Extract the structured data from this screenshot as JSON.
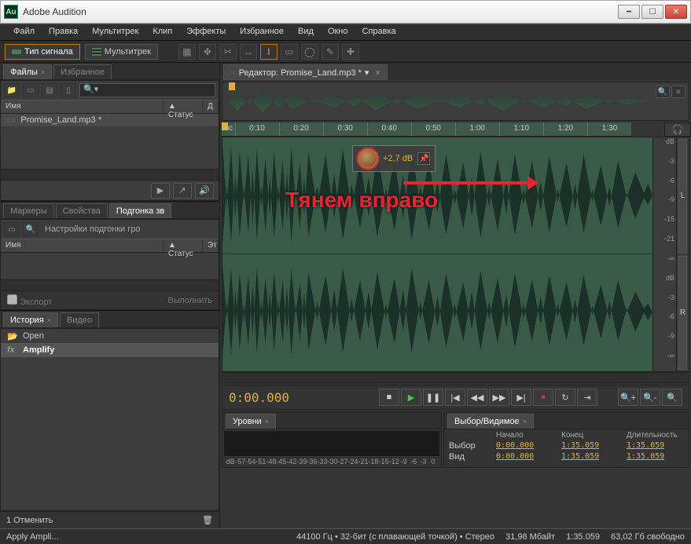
{
  "window": {
    "title": "Adobe Audition",
    "app_icon_text": "Au"
  },
  "win_buttons": {
    "min": "━",
    "max": "☐",
    "close": "✕"
  },
  "menu": [
    "Файл",
    "Правка",
    "Мультитрек",
    "Клип",
    "Эффекты",
    "Избранное",
    "Вид",
    "Окно",
    "Справка"
  ],
  "modes": {
    "signal": "Тип сигнала",
    "multitrack": "Мультитрек"
  },
  "left": {
    "files_tabs": {
      "files": "Файлы",
      "favorites": "Избранное"
    },
    "columns": {
      "name": "Имя",
      "status": "Статус",
      "dur": "Д"
    },
    "file": "Promise_Land.mp3 *",
    "markers_tabs": {
      "markers": "Маркеры",
      "props": "Свойства",
      "fit": "Подгонка зв"
    },
    "fit_settings": "Настройки подгонки гро",
    "columns2": {
      "name": "Имя",
      "status": "Статус",
      "et": "Эт"
    },
    "export": "Экспорт",
    "execute": "Выполнить",
    "history_tabs": {
      "history": "История",
      "video": "Видео"
    },
    "hist_open": "Open",
    "hist_amplify": "Amplify",
    "undo": "1 Отменить"
  },
  "editor": {
    "tab": "Редактор: Promise_Land.mp3 *",
    "timeline_unit": "мс",
    "timeline": [
      "0:10",
      "0:20",
      "0:30",
      "0:40",
      "0:50",
      "1:00",
      "1:10",
      "1:20",
      "1:30"
    ],
    "db_labels": [
      "dB",
      "-3",
      "-6",
      "-9",
      "-15",
      "-21",
      "-∞"
    ],
    "channel_L": "L",
    "channel_R": "R",
    "hud_value": "+2,7 dB",
    "annotation": "Тянем вправо",
    "headphones": "🎧"
  },
  "transport": {
    "timecode": "0:00.000",
    "buttons": {
      "stop": "■",
      "play": "▶",
      "pause": "❚❚",
      "begin": "|◀",
      "rew": "◀◀",
      "fwd": "▶▶",
      "end": "▶|",
      "rec": "●",
      "loop": "↻",
      "skip": "⇥"
    },
    "zoom": {
      "in": "🔍+",
      "out": "🔍-",
      "full": "🔍"
    }
  },
  "bottom": {
    "levels_tab": "Уровни",
    "levels_scale": [
      "dB",
      "-57",
      "-54",
      "-51",
      "-48",
      "-45",
      "-42",
      "-39",
      "-36",
      "-33",
      "-30",
      "-27",
      "-24",
      "-21",
      "-18",
      "-15",
      "-12",
      "-9",
      "-6",
      "-3",
      "0"
    ],
    "sel_tab": "Выбор/Видимое",
    "sel_headers": {
      "start": "Начало",
      "end": "Конец",
      "len": "Длительность"
    },
    "sel_rows": {
      "selection": {
        "label": "Выбор",
        "start": "0:00.000",
        "end": "1:35.059",
        "len": "1:35.059"
      },
      "view": {
        "label": "Вид",
        "start": "0:00.000",
        "end": "1:35.059",
        "len": "1:35.059"
      }
    }
  },
  "status": {
    "apply": "Apply Ampli...",
    "format": "44100 Гц • 32-бит (с плавающей точкой) • Стерео",
    "size": "31,98 Мбайт",
    "duration": "1:35.059",
    "free": "63,02 Гб свободно"
  },
  "icons": {
    "search": "🔍",
    "folder": "📁",
    "play_sm": "▶",
    "export": "↗",
    "speaker": "🔊",
    "trash": "🗑",
    "fx": "fx",
    "open": "📂"
  }
}
